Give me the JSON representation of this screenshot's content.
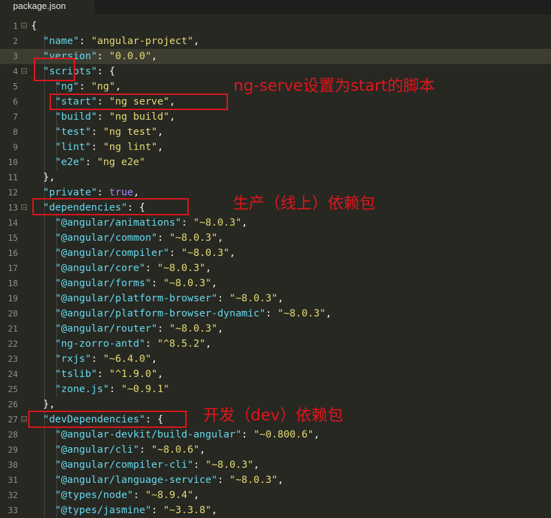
{
  "tab": {
    "title": "package.json"
  },
  "lines": [
    {
      "n": "1",
      "fold": true,
      "indent": 0,
      "tokens": [
        {
          "t": "{",
          "c": "p"
        }
      ]
    },
    {
      "n": "2",
      "indent": 1,
      "tokens": [
        {
          "t": "\"name\"",
          "c": "k"
        },
        {
          "t": ": ",
          "c": "p"
        },
        {
          "t": "\"angular-project\"",
          "c": "s"
        },
        {
          "t": ",",
          "c": "p"
        }
      ]
    },
    {
      "n": "3",
      "indent": 1,
      "hl": true,
      "tokens": [
        {
          "t": "\"version\"",
          "c": "k"
        },
        {
          "t": ": ",
          "c": "p"
        },
        {
          "t": "\"0.0.0\"",
          "c": "s"
        },
        {
          "t": ",",
          "c": "p"
        }
      ]
    },
    {
      "n": "4",
      "fold": true,
      "indent": 1,
      "tokens": [
        {
          "t": "\"scripts\"",
          "c": "k"
        },
        {
          "t": ": {",
          "c": "p"
        }
      ]
    },
    {
      "n": "5",
      "indent": 2,
      "tokens": [
        {
          "t": "\"ng\"",
          "c": "k"
        },
        {
          "t": ": ",
          "c": "p"
        },
        {
          "t": "\"ng\"",
          "c": "s"
        },
        {
          "t": ",",
          "c": "p"
        }
      ]
    },
    {
      "n": "6",
      "indent": 2,
      "tokens": [
        {
          "t": "\"start\"",
          "c": "k"
        },
        {
          "t": ": ",
          "c": "p"
        },
        {
          "t": "\"ng serve\"",
          "c": "s"
        },
        {
          "t": ",",
          "c": "p"
        }
      ]
    },
    {
      "n": "7",
      "indent": 2,
      "tokens": [
        {
          "t": "\"build\"",
          "c": "k"
        },
        {
          "t": ": ",
          "c": "p"
        },
        {
          "t": "\"ng build\"",
          "c": "s"
        },
        {
          "t": ",",
          "c": "p"
        }
      ]
    },
    {
      "n": "8",
      "indent": 2,
      "tokens": [
        {
          "t": "\"test\"",
          "c": "k"
        },
        {
          "t": ": ",
          "c": "p"
        },
        {
          "t": "\"ng test\"",
          "c": "s"
        },
        {
          "t": ",",
          "c": "p"
        }
      ]
    },
    {
      "n": "9",
      "indent": 2,
      "tokens": [
        {
          "t": "\"lint\"",
          "c": "k"
        },
        {
          "t": ": ",
          "c": "p"
        },
        {
          "t": "\"ng lint\"",
          "c": "s"
        },
        {
          "t": ",",
          "c": "p"
        }
      ]
    },
    {
      "n": "10",
      "indent": 2,
      "tokens": [
        {
          "t": "\"e2e\"",
          "c": "k"
        },
        {
          "t": ": ",
          "c": "p"
        },
        {
          "t": "\"ng e2e\"",
          "c": "s"
        }
      ]
    },
    {
      "n": "11",
      "indent": 1,
      "tokens": [
        {
          "t": "},",
          "c": "p"
        }
      ]
    },
    {
      "n": "12",
      "indent": 1,
      "tokens": [
        {
          "t": "\"private\"",
          "c": "k"
        },
        {
          "t": ": ",
          "c": "p"
        },
        {
          "t": "true",
          "c": "c"
        },
        {
          "t": ",",
          "c": "p"
        }
      ]
    },
    {
      "n": "13",
      "fold": true,
      "indent": 1,
      "tokens": [
        {
          "t": "\"dependencies\"",
          "c": "k"
        },
        {
          "t": ": {",
          "c": "p"
        }
      ]
    },
    {
      "n": "14",
      "indent": 2,
      "tokens": [
        {
          "t": "\"@angular/animations\"",
          "c": "k"
        },
        {
          "t": ": ",
          "c": "p"
        },
        {
          "t": "\"~8.0.3\"",
          "c": "s"
        },
        {
          "t": ",",
          "c": "p"
        }
      ]
    },
    {
      "n": "15",
      "indent": 2,
      "tokens": [
        {
          "t": "\"@angular/common\"",
          "c": "k"
        },
        {
          "t": ": ",
          "c": "p"
        },
        {
          "t": "\"~8.0.3\"",
          "c": "s"
        },
        {
          "t": ",",
          "c": "p"
        }
      ]
    },
    {
      "n": "16",
      "indent": 2,
      "tokens": [
        {
          "t": "\"@angular/compiler\"",
          "c": "k"
        },
        {
          "t": ": ",
          "c": "p"
        },
        {
          "t": "\"~8.0.3\"",
          "c": "s"
        },
        {
          "t": ",",
          "c": "p"
        }
      ]
    },
    {
      "n": "17",
      "indent": 2,
      "tokens": [
        {
          "t": "\"@angular/core\"",
          "c": "k"
        },
        {
          "t": ": ",
          "c": "p"
        },
        {
          "t": "\"~8.0.3\"",
          "c": "s"
        },
        {
          "t": ",",
          "c": "p"
        }
      ]
    },
    {
      "n": "18",
      "indent": 2,
      "tokens": [
        {
          "t": "\"@angular/forms\"",
          "c": "k"
        },
        {
          "t": ": ",
          "c": "p"
        },
        {
          "t": "\"~8.0.3\"",
          "c": "s"
        },
        {
          "t": ",",
          "c": "p"
        }
      ]
    },
    {
      "n": "19",
      "indent": 2,
      "tokens": [
        {
          "t": "\"@angular/platform-browser\"",
          "c": "k"
        },
        {
          "t": ": ",
          "c": "p"
        },
        {
          "t": "\"~8.0.3\"",
          "c": "s"
        },
        {
          "t": ",",
          "c": "p"
        }
      ]
    },
    {
      "n": "20",
      "indent": 2,
      "tokens": [
        {
          "t": "\"@angular/platform-browser-dynamic\"",
          "c": "k"
        },
        {
          "t": ": ",
          "c": "p"
        },
        {
          "t": "\"~8.0.3\"",
          "c": "s"
        },
        {
          "t": ",",
          "c": "p"
        }
      ]
    },
    {
      "n": "21",
      "indent": 2,
      "tokens": [
        {
          "t": "\"@angular/router\"",
          "c": "k"
        },
        {
          "t": ": ",
          "c": "p"
        },
        {
          "t": "\"~8.0.3\"",
          "c": "s"
        },
        {
          "t": ",",
          "c": "p"
        }
      ]
    },
    {
      "n": "22",
      "indent": 2,
      "tokens": [
        {
          "t": "\"ng-zorro-antd\"",
          "c": "k"
        },
        {
          "t": ": ",
          "c": "p"
        },
        {
          "t": "\"^8.5.2\"",
          "c": "s"
        },
        {
          "t": ",",
          "c": "p"
        }
      ]
    },
    {
      "n": "23",
      "indent": 2,
      "tokens": [
        {
          "t": "\"rxjs\"",
          "c": "k"
        },
        {
          "t": ": ",
          "c": "p"
        },
        {
          "t": "\"~6.4.0\"",
          "c": "s"
        },
        {
          "t": ",",
          "c": "p"
        }
      ]
    },
    {
      "n": "24",
      "indent": 2,
      "tokens": [
        {
          "t": "\"tslib\"",
          "c": "k"
        },
        {
          "t": ": ",
          "c": "p"
        },
        {
          "t": "\"^1.9.0\"",
          "c": "s"
        },
        {
          "t": ",",
          "c": "p"
        }
      ]
    },
    {
      "n": "25",
      "indent": 2,
      "tokens": [
        {
          "t": "\"zone.js\"",
          "c": "k"
        },
        {
          "t": ": ",
          "c": "p"
        },
        {
          "t": "\"~0.9.1\"",
          "c": "s"
        }
      ]
    },
    {
      "n": "26",
      "indent": 1,
      "tokens": [
        {
          "t": "},",
          "c": "p"
        }
      ]
    },
    {
      "n": "27",
      "fold": true,
      "indent": 1,
      "tokens": [
        {
          "t": "\"devDependencies\"",
          "c": "k"
        },
        {
          "t": ": {",
          "c": "p"
        }
      ]
    },
    {
      "n": "28",
      "indent": 2,
      "tokens": [
        {
          "t": "\"@angular-devkit/build-angular\"",
          "c": "k"
        },
        {
          "t": ": ",
          "c": "p"
        },
        {
          "t": "\"~0.800.6\"",
          "c": "s"
        },
        {
          "t": ",",
          "c": "p"
        }
      ]
    },
    {
      "n": "29",
      "indent": 2,
      "tokens": [
        {
          "t": "\"@angular/cli\"",
          "c": "k"
        },
        {
          "t": ": ",
          "c": "p"
        },
        {
          "t": "\"~8.0.6\"",
          "c": "s"
        },
        {
          "t": ",",
          "c": "p"
        }
      ]
    },
    {
      "n": "30",
      "indent": 2,
      "tokens": [
        {
          "t": "\"@angular/compiler-cli\"",
          "c": "k"
        },
        {
          "t": ": ",
          "c": "p"
        },
        {
          "t": "\"~8.0.3\"",
          "c": "s"
        },
        {
          "t": ",",
          "c": "p"
        }
      ]
    },
    {
      "n": "31",
      "indent": 2,
      "tokens": [
        {
          "t": "\"@angular/language-service\"",
          "c": "k"
        },
        {
          "t": ": ",
          "c": "p"
        },
        {
          "t": "\"~8.0.3\"",
          "c": "s"
        },
        {
          "t": ",",
          "c": "p"
        }
      ]
    },
    {
      "n": "32",
      "indent": 2,
      "tokens": [
        {
          "t": "\"@types/node\"",
          "c": "k"
        },
        {
          "t": ": ",
          "c": "p"
        },
        {
          "t": "\"~8.9.4\"",
          "c": "s"
        },
        {
          "t": ",",
          "c": "p"
        }
      ]
    },
    {
      "n": "33",
      "indent": 2,
      "tokens": [
        {
          "t": "\"@types/jasmine\"",
          "c": "k"
        },
        {
          "t": ": ",
          "c": "p"
        },
        {
          "t": "\"~3.3.8\"",
          "c": "s"
        },
        {
          "t": ",",
          "c": "p"
        }
      ]
    }
  ],
  "annotations": {
    "scripts_note": "ng-serve设置为start的脚本",
    "dependencies_note": "生产（线上）依赖包",
    "dev_dependencies_note": "开发（dev）依赖包",
    "color": "#e0161c"
  }
}
